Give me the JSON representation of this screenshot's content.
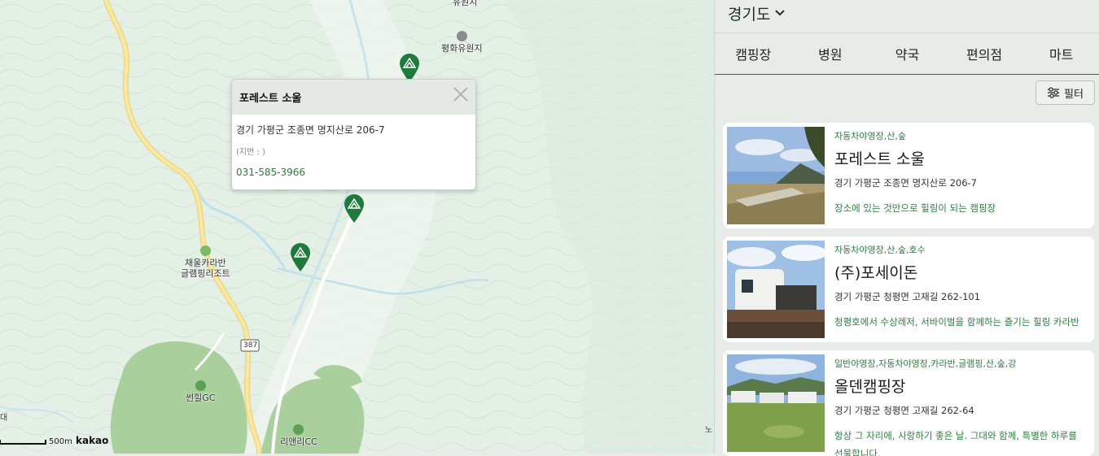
{
  "map": {
    "pois": [
      {
        "name": "유원지",
        "kind": "top"
      },
      {
        "name": "평화유원지",
        "kind": "camera"
      },
      {
        "name": "채울카라반\n글램핑리조트",
        "kind": "camp"
      },
      {
        "name": "썬힐GC",
        "kind": "golf"
      },
      {
        "name": "리앤리CC",
        "kind": "golf"
      }
    ],
    "road_label": "387",
    "scale_label": "500m",
    "logo": "kakao",
    "edge_labels": [
      "대",
      "노"
    ]
  },
  "popup": {
    "title": "포레스트 소울",
    "address": "경기 가평군 조종면 명지산로 206-7",
    "jibun": "(지번 : )",
    "phone": "031-585-3966"
  },
  "panel": {
    "region": "경기도",
    "tabs": [
      "캠핑장",
      "병원",
      "약국",
      "편의점",
      "마트"
    ],
    "filter_label": "필터",
    "cards": [
      {
        "category": "자동차야영장,산,숲",
        "name": "포레스트 소울",
        "address": "경기 가평군 조종면 명지산로 206-7",
        "description": "장소에 있는 것만으로 힐링이 되는 캠핑장"
      },
      {
        "category": "자동차야영장,산,숲,호수",
        "name": "(주)포세이돈",
        "address": "경기 가평군 청평면 고재길 262-101",
        "description": "청평호에서 수상레저, 서바이벌을 함께하는 즐기는 힐링 카라반"
      },
      {
        "category": "일반야영장,자동차야영장,카라반,글램핑,산,숲,강",
        "name": "올덴캠핑장",
        "address": "경기 가평군 청평면 고재길 262-64",
        "description": "항상 그 자리에, 사랑하기 좋은 날. 그대와 함께, 특별한 하루를 선물합니다."
      }
    ]
  },
  "colors": {
    "accent": "#2a7d3e",
    "marker": "#1f7a3c"
  }
}
